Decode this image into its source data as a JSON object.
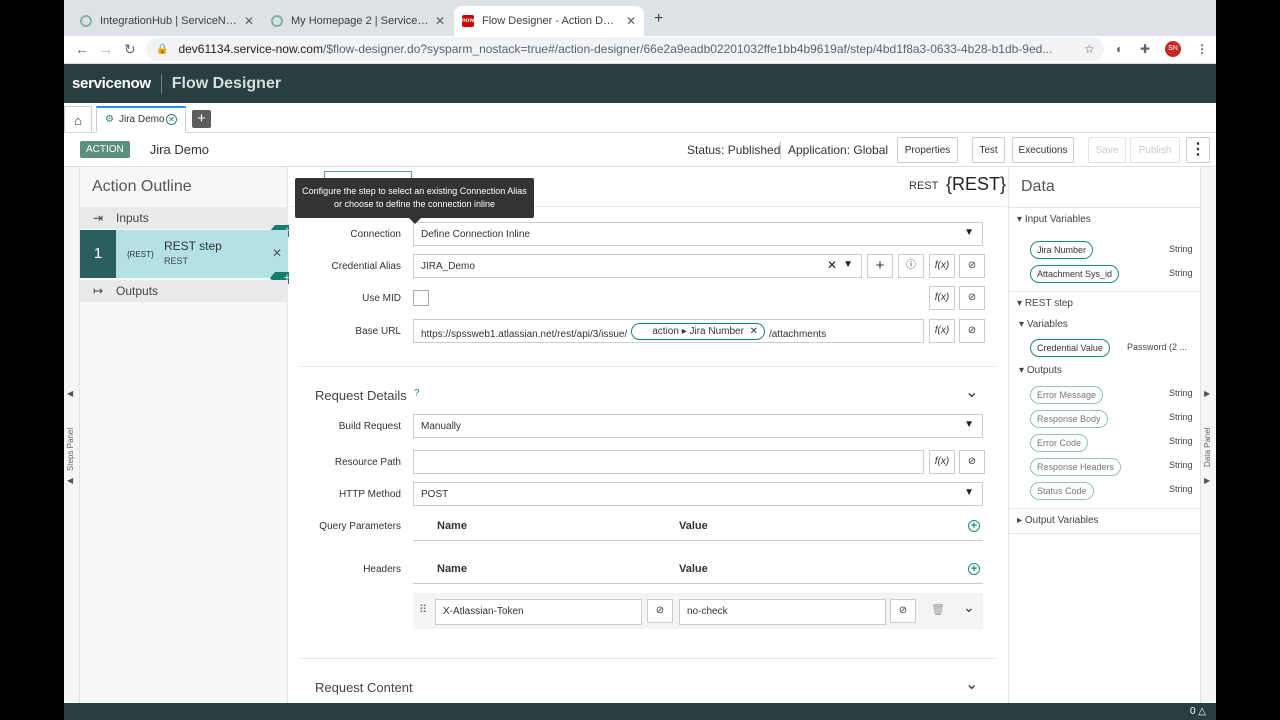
{
  "browser": {
    "tabs": [
      {
        "label": "IntegrationHub | ServiceNow D",
        "close": "✕"
      },
      {
        "label": "My Homepage 2 | ServiceNow",
        "close": "✕"
      },
      {
        "label": "Flow Designer - Action Designer",
        "close": "✕",
        "favicon_text": "now"
      }
    ],
    "new_tab": "+",
    "url_host": "dev61134.service-now.com",
    "url_path": "/$flow-designer.do?sysparm_nostack=true#/action-designer/66e2a9eadb02201032ffe1bb4b9619af/step/4bd1f8a3-0633-4b28-b1db-9ed...",
    "profile_initials": "SN"
  },
  "header": {
    "logo": "servicenow",
    "app_title": "Flow Designer"
  },
  "designer_tabs": {
    "home_icon": "⌂",
    "active_tab": "Jira Demo",
    "add": "+"
  },
  "action": {
    "badge": "ACTION",
    "name": "Jira Demo",
    "status": "Status: Published",
    "application": "Application: Global",
    "buttons": {
      "properties": "Properties",
      "test": "Test",
      "executions": "Executions",
      "save": "Save",
      "publish": "Publish"
    }
  },
  "side_panels": {
    "left_label": "Steps Panel",
    "right_label": "Data Panel"
  },
  "outline": {
    "title": "Action Outline",
    "inputs": "Inputs",
    "step_number": "1",
    "step_tag": "{REST}",
    "step_name": "REST step",
    "step_type": "REST",
    "outputs": "Outputs"
  },
  "tooltip": "Configure the step to select an existing Connection Alias or choose to define the connection inline",
  "step": {
    "header_title": "REST step",
    "rest_small": "REST",
    "rest_big": "{REST}",
    "connection_label": "Connection",
    "connection_value": "Define Connection Inline",
    "credential_label": "Credential Alias",
    "credential_value": "JIRA_Demo",
    "use_mid_label": "Use MID",
    "base_url_label": "Base URL",
    "base_url_prefix": "https://spssweb1.atlassian.net/rest/api/3/issue/",
    "base_url_pill": "action ▸ Jira Number",
    "base_url_suffix": "/attachments",
    "fx": "f(x)"
  },
  "request_details": {
    "title": "Request Details",
    "build_request_label": "Build Request",
    "build_request_value": "Manually",
    "resource_path_label": "Resource Path",
    "resource_path_value": "",
    "http_method_label": "HTTP Method",
    "http_method_value": "POST",
    "query_params_label": "Query Parameters",
    "headers_label": "Headers",
    "col_name": "Name",
    "col_value": "Value",
    "header_rows": [
      {
        "name": "X-Atlassian-Token",
        "value": "no-check"
      }
    ]
  },
  "request_content": {
    "title": "Request Content"
  },
  "data_panel": {
    "title": "Data",
    "input_variables": "Input Variables",
    "inputs": [
      {
        "label": "Jira Number",
        "type": "String"
      },
      {
        "label": "Attachment Sys_id",
        "type": "String"
      }
    ],
    "rest_step": "REST step",
    "variables": "Variables",
    "variable_items": [
      {
        "label": "Credential Value",
        "type": "Password (2 ..."
      }
    ],
    "outputs_label": "Outputs",
    "outputs": [
      {
        "label": "Error Message",
        "type": "String"
      },
      {
        "label": "Response Body",
        "type": "String"
      },
      {
        "label": "Error Code",
        "type": "String"
      },
      {
        "label": "Response Headers",
        "type": "String"
      },
      {
        "label": "Status Code",
        "type": "String"
      }
    ],
    "output_variables": "Output Variables"
  },
  "footer": {
    "notifications": "0"
  }
}
